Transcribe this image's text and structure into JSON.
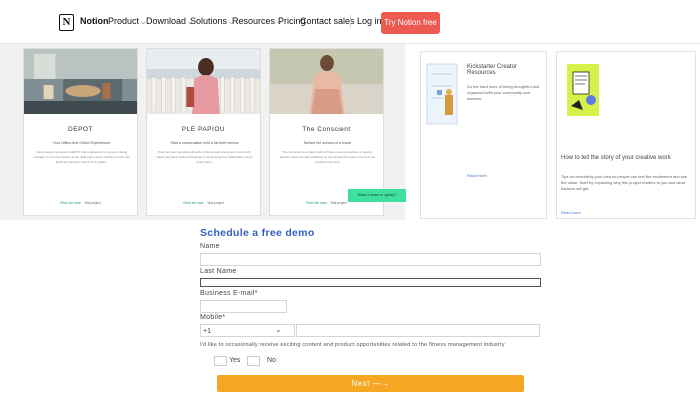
{
  "nav": {
    "brand": "Notion",
    "items": [
      {
        "label": "Product"
      },
      {
        "label": "Download"
      },
      {
        "label": "Solutions"
      },
      {
        "label": "Resources"
      },
      {
        "label": "Pricing"
      }
    ],
    "contact_sales": "Contact sales",
    "login": "Log in",
    "cta": "Try Notion free"
  },
  "cards": [
    {
      "title": "DEPOT",
      "subtitle": "Your Offline-first Online Experiences",
      "description": "Some design concepts in DEPOT that emphasize the sense of being nostalgic for the time before all the walls came down. Nothing exists now that has only been real all of a sudden.",
      "link_primary": "Read the case",
      "link_secondary": "Visit project"
    },
    {
      "title": "PLE PAPIOU",
      "subtitle": "Start a conversation with a full brief service",
      "description": "PLE has been providing all sorts of clients with a long-term look which helps bring their ideas and feelings to life through the collaboration of the entire team.",
      "link_primary": "Read the case",
      "link_secondary": "Visit project"
    },
    {
      "title": "The Conscient",
      "subtitle": "Behind the scenes of a brand",
      "description": "The Conscient is a brand built to bring a new perspective on beauty, skincare and everyday wellbeing for the people who want more from the products they love.",
      "link_primary": "Read the case",
      "link_secondary": "Visit project"
    }
  ],
  "group_button": "Have a team or group?",
  "right_panels": [
    {
      "title": "Kickstarter Creator Resources",
      "text": "Do the hard work of being thoughtful and organized with your community and backers.",
      "link": "Read more"
    },
    {
      "title": "How to tell the story of your creative work",
      "text": "Tips for describing your idea so people can feel the excitement and see the value. Start by explaining why this project matters to you and what backers will get.",
      "link": "Read more"
    }
  ],
  "form": {
    "title": "Schedule a free demo",
    "name_label": "Name",
    "last_name_label": "Last Name",
    "email_label": "Business E-mail*",
    "mobile_label": "Mobile*",
    "country_code": "+1",
    "consent": "I'd like to occasionally receive exciting content and product opportunities related to the fitness management industry",
    "yes": "Yes",
    "no": "No",
    "next": "Next —→"
  },
  "colors": {
    "cta": "#ee5a52",
    "form_title": "#2f5fc4",
    "next_button": "#f5a623",
    "group_button": "#3ee0a0"
  }
}
